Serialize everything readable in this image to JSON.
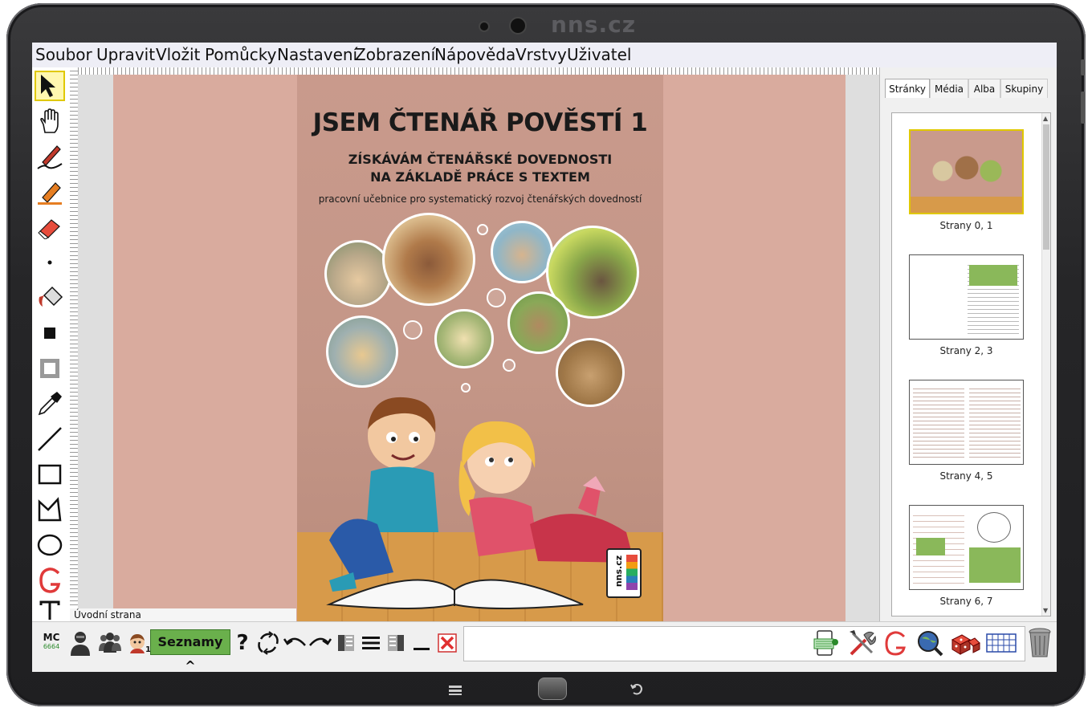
{
  "brand": "nns.cz",
  "menu": {
    "items": [
      "Soubor",
      "Upravit",
      "Vložit",
      "Pomůcky",
      "Nastavení",
      "Zobrazení",
      "Nápověda",
      "Vrstvy",
      "Uživatel"
    ]
  },
  "cover": {
    "title": "JSEM ČTENÁŘ POVĚSTÍ 1",
    "subtitle_line1": "ZÍSKÁVÁM ČTENÁŘSKÉ DOVEDNOSTI",
    "subtitle_line2": "NA ZÁKLADĚ PRÁCE S TEXTEM",
    "tagline": "pracovní učebnice pro systematický rozvoj čtenářských dovedností",
    "logo_text": "nns.cz"
  },
  "page_label": "Úvodní strana",
  "panel": {
    "tabs": [
      "Stránky",
      "Média",
      "Alba",
      "Skupiny"
    ],
    "thumbnails": [
      "Strany 0, 1",
      "Strany 2, 3",
      "Strany 4, 5",
      "Strany 6, 7"
    ]
  },
  "bottombar": {
    "mc_label": "MC",
    "mc_number": "6664",
    "pupil_number": "1",
    "lists_button": "Seznamy ^",
    "help": "?"
  },
  "colors": {
    "page_bg": "#d9ab9e",
    "selection": "#e0c800",
    "lists_button": "#6ab04c"
  }
}
